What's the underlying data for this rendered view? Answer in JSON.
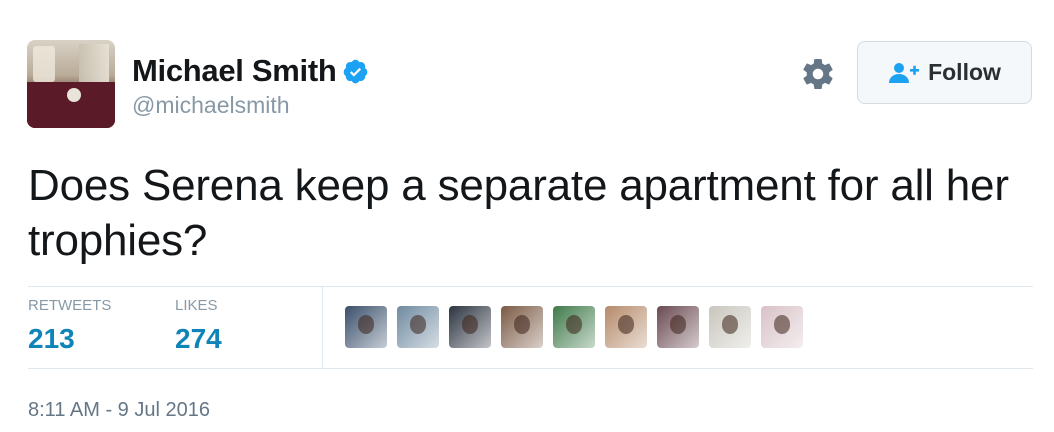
{
  "user": {
    "name": "Michael Smith",
    "handle": "@michaelsmith"
  },
  "actions": {
    "follow_label": "Follow"
  },
  "tweet": {
    "text": "Does Serena keep a separate apartment for all her trophies?",
    "timestamp": "8:11 AM - 9 Jul 2016"
  },
  "stats": {
    "retweets_label": "RETWEETS",
    "retweets_value": "213",
    "likes_label": "LIKES",
    "likes_value": "274"
  },
  "likers": [
    {
      "color": "#3a4f6b"
    },
    {
      "color": "#6f8aa0"
    },
    {
      "color": "#2c3440"
    },
    {
      "color": "#7b5a45"
    },
    {
      "color": "#3f7a4a"
    },
    {
      "color": "#b58a6a"
    },
    {
      "color": "#6a4a52"
    },
    {
      "color": "#c9c6bd"
    },
    {
      "color": "#d8c2c7"
    }
  ],
  "icons": {
    "verified": "verified-badge-icon",
    "settings": "gear-icon",
    "follow": "add-user-icon"
  },
  "colors": {
    "accent": "#1da1f2",
    "stat_value": "#0e84b8",
    "muted": "#8899a6"
  }
}
